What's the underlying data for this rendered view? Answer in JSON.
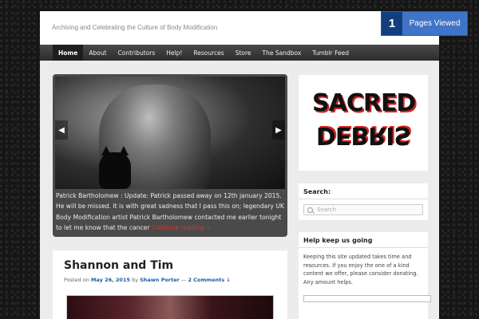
{
  "site": {
    "tagline": "Archiving and Celebrating the Culture of Body Modification"
  },
  "pages_viewed": {
    "count": "1",
    "label": "Pages Viewed"
  },
  "nav": {
    "items": [
      {
        "label": "Home",
        "active": true
      },
      {
        "label": "About"
      },
      {
        "label": "Contributors"
      },
      {
        "label": "Help!"
      },
      {
        "label": "Resources"
      },
      {
        "label": "Store"
      },
      {
        "label": "The Sandbox"
      },
      {
        "label": "Tumblr Feed"
      }
    ]
  },
  "slider": {
    "prev_icon": "chevron-left-icon",
    "next_icon": "chevron-right-icon",
    "caption": "Patrick Bartholomew : Update: Patrick passed away on 12th january 2015. He will be missed. It is with great sadness that I pass this on; legendary UK Body Modification artist Patrick Bartholomew contacted me earlier tonight to let me know that the cancer ",
    "more_link": "Continue reading →"
  },
  "post": {
    "title": "Shannon and Tim",
    "posted_on": "Posted on ",
    "date": "May 26, 2015",
    "by": " by ",
    "author": "Shawn Porter",
    "separator": " — ",
    "comments": "2 Comments ↓"
  },
  "logo": {
    "line1": "SACRED",
    "line2": "DEBRIS"
  },
  "search": {
    "title": "Search:",
    "placeholder": "Search"
  },
  "help": {
    "title": "Help keep us going",
    "text": "Keeping this site updated takes time and resources. If you enjoy the one of a kind content we offer, please consider donating. Any amount helps."
  },
  "colors": {
    "accent": "#3f74c8",
    "link": "#1b5ca8",
    "more_link": "#dd3333"
  }
}
